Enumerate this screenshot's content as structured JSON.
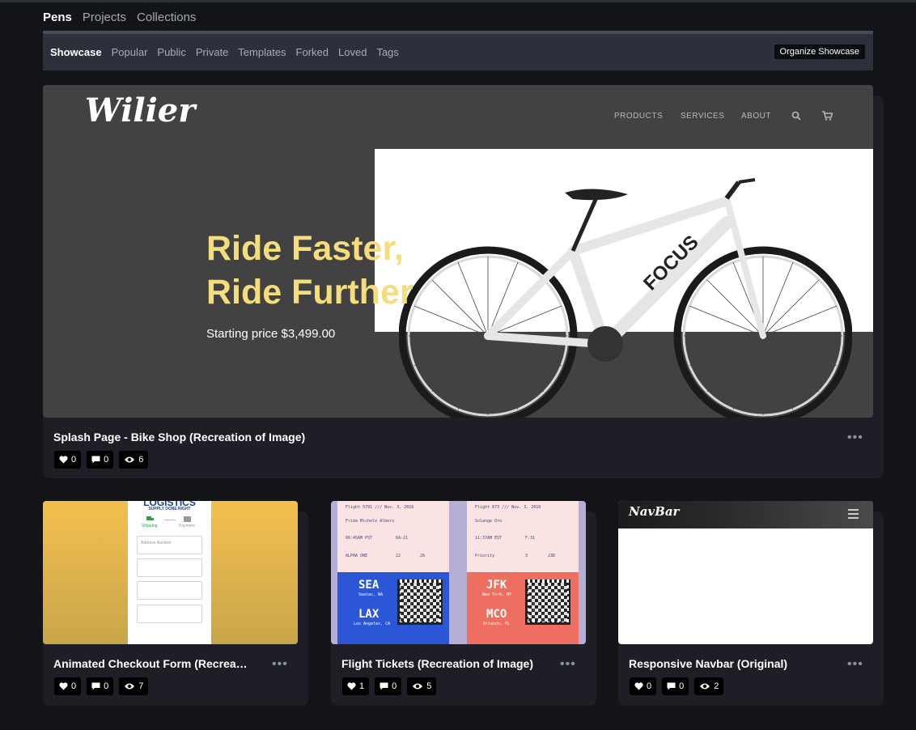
{
  "primary_tabs": [
    "Pens",
    "Projects",
    "Collections"
  ],
  "sub_nav": [
    "Showcase",
    "Popular",
    "Public",
    "Private",
    "Templates",
    "Forked",
    "Loved",
    "Tags"
  ],
  "organize_button": "Organize Showcase",
  "colors": {
    "page_bg": "#131417",
    "card_bg": "#1e1f26",
    "accent_yellow": "#f3dd7d"
  },
  "featured": {
    "preview": {
      "logo": "Wilier",
      "nav": [
        "PRODUCTS",
        "SERVICES",
        "ABOUT"
      ],
      "nav_icons": [
        "search-icon",
        "cart-icon"
      ],
      "headline_line1": "Ride Faster,",
      "headline_line2": "Ride Further",
      "price": "Starting price $3,499.00",
      "bike_brand": "FOCUS"
    },
    "title": "Splash Page - Bike Shop (Recreation of Image)",
    "likes": "0",
    "comments": "0",
    "views": "6"
  },
  "cards": [
    {
      "title": "Animated Checkout Form (Recrea…",
      "likes": "0",
      "comments": "0",
      "views": "7",
      "preview": {
        "logo": "LOGISTICS",
        "tagline": "SUPPLY DONE RIGHT",
        "step1": "Shipping",
        "step2": "Payment",
        "field_placeholder": "Address Number"
      }
    },
    {
      "title": "Flight Tickets (Recreation of Image)",
      "likes": "1",
      "comments": "0",
      "views": "5",
      "preview": {
        "left": {
          "flight": "Flight 5791 /// Nov. 3, 2016",
          "name": "Frida Michele Albers",
          "time": "06:45AM PST",
          "gate": "6A-21",
          "group": "ALPHA ONE",
          "seat": "22",
          "row": "2A",
          "from": "SEA",
          "from_city": "Seatac, WA",
          "to": "LAX",
          "to_city": "Los Angeles, CA"
        },
        "right": {
          "flight": "Flight 673 /// Nov. 3, 2016",
          "name": "Solange Oro",
          "time": "11:37AM EST",
          "gate": "F-31",
          "group": "Priority",
          "seat": "3",
          "row": "23D",
          "from": "JFK",
          "from_city": "New York, NY",
          "to": "MCO",
          "to_city": "Orlando, FL"
        }
      }
    },
    {
      "title": "Responsive Navbar (Original)",
      "likes": "0",
      "comments": "0",
      "views": "2",
      "preview": {
        "logo": "NavBar"
      }
    }
  ]
}
